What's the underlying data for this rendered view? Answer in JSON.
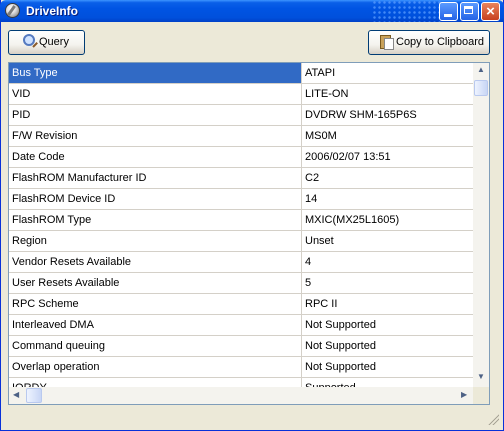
{
  "window": {
    "title": "DriveInfo"
  },
  "toolbar": {
    "query_label": "Query",
    "copy_label": "Copy to Clipboard"
  },
  "rows": [
    {
      "key": "Bus Type",
      "value": "ATAPI",
      "selected": true
    },
    {
      "key": "VID",
      "value": "LITE-ON"
    },
    {
      "key": "PID",
      "value": "DVDRW SHM-165P6S"
    },
    {
      "key": "F/W Revision",
      "value": "MS0M"
    },
    {
      "key": "Date Code",
      "value": "2006/02/07 13:51"
    },
    {
      "key": "FlashROM Manufacturer ID",
      "value": "C2"
    },
    {
      "key": "FlashROM Device ID",
      "value": "14"
    },
    {
      "key": "FlashROM Type",
      "value": "MXIC(MX25L1605)"
    },
    {
      "key": "Region",
      "value": "Unset"
    },
    {
      "key": "Vendor Resets Available",
      "value": "4"
    },
    {
      "key": "User Resets Available",
      "value": "5"
    },
    {
      "key": "RPC Scheme",
      "value": "RPC II"
    },
    {
      "key": "Interleaved DMA",
      "value": "Not Supported"
    },
    {
      "key": "Command queuing",
      "value": "Not Supported"
    },
    {
      "key": "Overlap operation",
      "value": "Not Supported"
    },
    {
      "key": "IORDY",
      "value": "Supported"
    }
  ],
  "icons": {
    "app": "disc-icon",
    "query": "magnifier-icon",
    "copy": "clipboard-icon"
  },
  "colors": {
    "titlebar": "#0054e3",
    "selection": "#316ac5",
    "face": "#ece9d8"
  }
}
